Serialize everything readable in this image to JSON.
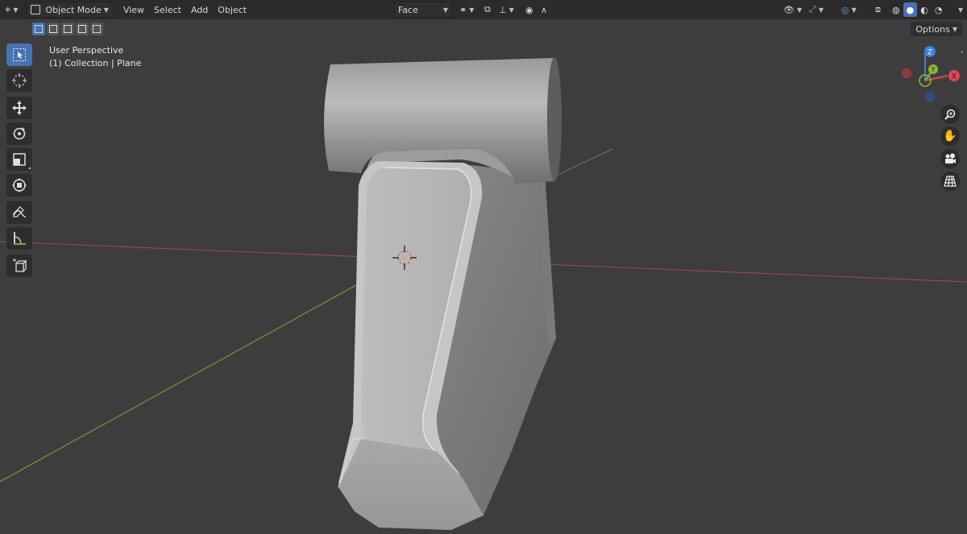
{
  "header": {
    "editor_type_icon": "editor-type-icon",
    "mode": "Object Mode",
    "menus": [
      "View",
      "Select",
      "Add",
      "Object"
    ],
    "orientation": "Face",
    "icons": [
      "transform-pivot-icon",
      "snap-icon",
      "snap-target-icon",
      "proportional-editing-icon",
      "falloff-icon",
      "visibility-icon",
      "gizmo-icon",
      "overlay-icon",
      "xray-icon",
      "wireframe-shading-icon",
      "solid-shading-icon",
      "material-shading-icon",
      "rendered-shading-icon"
    ]
  },
  "toolrow": {
    "options_label": "Options",
    "selection_modes": [
      "select-new",
      "select-extend",
      "select-subtract",
      "select-invert",
      "select-intersect"
    ]
  },
  "toolbar": {
    "tools": [
      "select-box",
      "cursor",
      "move",
      "rotate",
      "scale",
      "transform",
      "annotate",
      "measure",
      "add-cube"
    ],
    "active_tool": "select-box"
  },
  "overlay": {
    "perspective": "User Perspective",
    "collection": "(1) Collection | Plane"
  },
  "gizmo": {
    "axes": [
      "X",
      "Y",
      "Z"
    ],
    "colors": {
      "x": "#e0475a",
      "y": "#8cb437",
      "z": "#3b7fdb"
    }
  },
  "navigation": [
    "zoom-icon",
    "pan-hand-icon",
    "camera-icon",
    "grid-icon"
  ],
  "colors": {
    "accent": "#4772b3",
    "header_bg": "#2b2b2b",
    "viewport_bg": "#3d3d3d",
    "x_axis_line": "#b04a4a",
    "y_axis_line": "#7ea63b"
  }
}
